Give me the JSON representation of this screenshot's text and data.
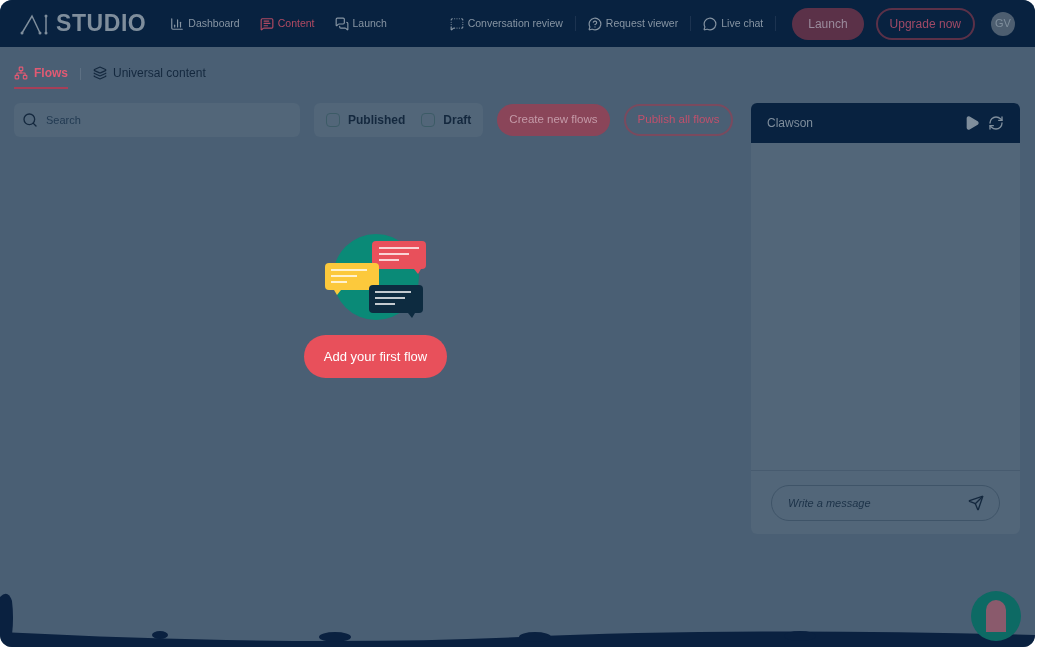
{
  "header": {
    "logo": "STUDIO",
    "nav": [
      {
        "label": "Dashboard",
        "selected": false
      },
      {
        "label": "Content",
        "selected": true
      },
      {
        "label": "Launch",
        "selected": false
      }
    ],
    "tools": [
      "Conversation review",
      "Request viewer",
      "Live chat"
    ],
    "launch_button": "Launch",
    "upgrade_button": "Upgrade now",
    "avatar": "GV"
  },
  "tabs": [
    {
      "label": "Flows",
      "selected": true
    },
    {
      "label": "Universal content",
      "selected": false
    }
  ],
  "search": {
    "placeholder": "Search"
  },
  "filters": [
    {
      "label": "Published",
      "checked": false
    },
    {
      "label": "Draft",
      "checked": false
    }
  ],
  "create_button": "Create new flows",
  "publish_button": "Publish all flows",
  "empty_state": {
    "button": "Add your first flow"
  },
  "chat": {
    "title": "Clawson",
    "placeholder": "Write a message"
  }
}
